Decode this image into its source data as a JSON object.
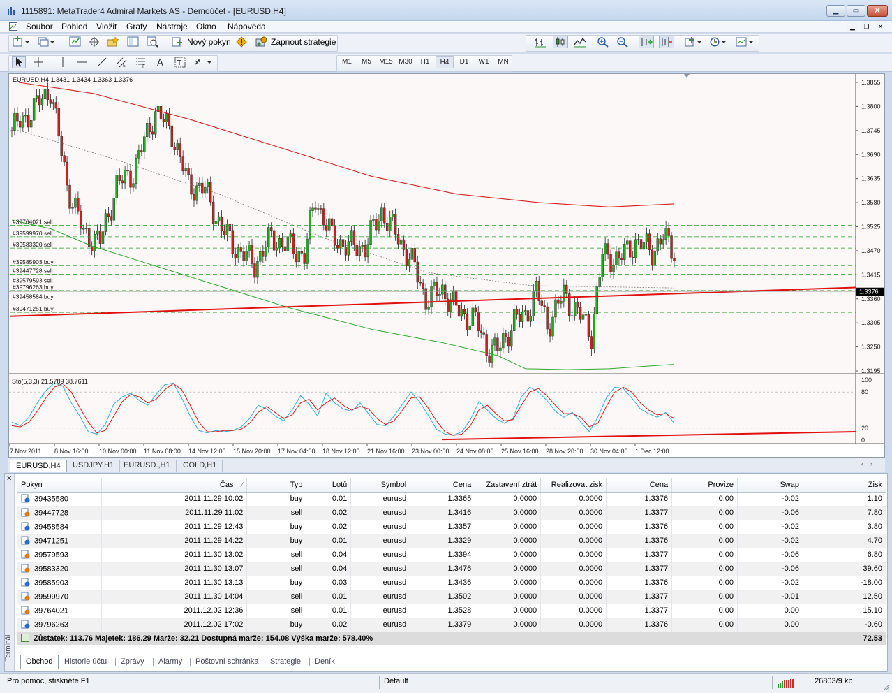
{
  "window": {
    "title": "1115891: MetaTrader4 Admiral Markets AS - Demoúčet - [EURUSD,H4]"
  },
  "menu": {
    "items": [
      "Soubor",
      "Pohled",
      "Vložit",
      "Grafy",
      "Nástroje",
      "Okno",
      "Nápověda"
    ]
  },
  "toolbar": {
    "new_order_label": "Nový pokyn",
    "autotrade_label": "Zapnout strategie"
  },
  "timeframes": [
    "M1",
    "M5",
    "M15",
    "M30",
    "H1",
    "H4",
    "D1",
    "W1",
    "MN"
  ],
  "active_timeframe": "H4",
  "chart_data": [
    {
      "type": "candlestick",
      "title": "EURUSD,H4 1.3431 1.3434 1.3363 1.3376",
      "ylim": [
        1.3195,
        1.3855
      ],
      "y_ticks": [
        "1.3855",
        "1.3800",
        "1.3745",
        "1.3690",
        "1.3635",
        "1.3580",
        "1.3525",
        "1.3470",
        "1.3415",
        "1.3360",
        "1.3305",
        "1.3250",
        "1.3195"
      ],
      "current_price": "1.3376",
      "x_ticks": [
        "7 Nov 2011",
        "8 Nov 16:00",
        "10 Nov 00:00",
        "11 Nov 08:00",
        "14 Nov 12:00",
        "15 Nov 20:00",
        "17 Nov 04:00",
        "18 Nov 12:00",
        "21 Nov 16:00",
        "23 Nov 00:00",
        "24 Nov 08:00",
        "25 Nov 16:00",
        "28 Nov 20:00",
        "30 Nov 04:00",
        "1 Dec 12:00"
      ],
      "trade_levels": [
        {
          "label": "#39764021 sell",
          "price": 1.3528
        },
        {
          "label": "#39599970 sell",
          "price": 1.3502
        },
        {
          "label": "#39583320 sell",
          "price": 1.3476
        },
        {
          "label": "#39585903 buy",
          "price": 1.3436
        },
        {
          "label": "#39447728 sell",
          "price": 1.3416
        },
        {
          "label": "#39579593 sell",
          "price": 1.3394
        },
        {
          "label": "#39796263 buy",
          "price": 1.3379
        },
        {
          "label": "#39458584 buy",
          "price": 1.3357
        },
        {
          "label": "#39471251 buy",
          "price": 1.3329
        }
      ],
      "colors": {
        "bull": "#22aa22",
        "bear": "#cc1f1f",
        "ma_slow": "#d42020",
        "ma_fast": "#2ea82e",
        "trend": "#e01010",
        "levels": "#1fa01f"
      }
    },
    {
      "type": "line",
      "title": "Sto(5,3,3) 21.5789 38.7611",
      "ylim": [
        0,
        100
      ],
      "y_ticks": [
        "100",
        "80",
        "20",
        "0"
      ],
      "series": [
        {
          "values": [
            30,
            24,
            38,
            62,
            82,
            95,
            90,
            62,
            40,
            14,
            10,
            26,
            60,
            72,
            78,
            66,
            58,
            76,
            92,
            95,
            70,
            40,
            16,
            12,
            16,
            14,
            16,
            22,
            36,
            58,
            52,
            40,
            32,
            50,
            74,
            60,
            40,
            78,
            62,
            52,
            48,
            62,
            44,
            26,
            24,
            40,
            60,
            80,
            64,
            42,
            18,
            10,
            8,
            14,
            34,
            64,
            50,
            36,
            28,
            36,
            72,
            88,
            80,
            66,
            48,
            38,
            46,
            30,
            14,
            38,
            70,
            88,
            86,
            70,
            52,
            44,
            38,
            46,
            28
          ]
        },
        {
          "values": [
            24,
            22,
            30,
            48,
            70,
            88,
            94,
            80,
            54,
            30,
            12,
            16,
            40,
            64,
            76,
            72,
            62,
            68,
            84,
            94,
            84,
            58,
            30,
            14,
            14,
            16,
            16,
            18,
            28,
            46,
            56,
            46,
            36,
            42,
            62,
            68,
            50,
            62,
            70,
            58,
            50,
            56,
            52,
            36,
            26,
            32,
            50,
            70,
            72,
            54,
            32,
            14,
            8,
            10,
            24,
            50,
            58,
            44,
            32,
            34,
            58,
            80,
            86,
            74,
            58,
            44,
            44,
            38,
            22,
            28,
            56,
            80,
            88,
            80,
            62,
            50,
            42,
            44,
            36
          ]
        }
      ],
      "colors": {
        "main": "#2bb0d8",
        "signal": "#d41c1c",
        "trend": "#e01010"
      }
    }
  ],
  "chart_tabs": [
    "EURUSD,H4",
    "USDJPY,H1",
    "EURUSD.,H1",
    "GOLD,H1"
  ],
  "orders": {
    "columns": [
      "Pokyn",
      "Čas",
      "Typ",
      "Lotů",
      "Symbol",
      "Cena",
      "Zastavení ztrát",
      "Realizovat zisk",
      "Cena",
      "Provize",
      "Swap",
      "Zisk"
    ],
    "rows": [
      [
        "39435580",
        "2011.11.29 10:02",
        "buy",
        "0.01",
        "eurusd",
        "1.3365",
        "0.0000",
        "0.0000",
        "1.3376",
        "0.00",
        "-0.02",
        "1.10"
      ],
      [
        "39447728",
        "2011.11.29 11:02",
        "sell",
        "0.02",
        "eurusd",
        "1.3416",
        "0.0000",
        "0.0000",
        "1.3377",
        "0.00",
        "-0.06",
        "7.80"
      ],
      [
        "39458584",
        "2011.11.29 12:43",
        "buy",
        "0.02",
        "eurusd",
        "1.3357",
        "0.0000",
        "0.0000",
        "1.3376",
        "0.00",
        "-0.02",
        "3.80"
      ],
      [
        "39471251",
        "2011.11.29 14:22",
        "buy",
        "0.01",
        "eurusd",
        "1.3329",
        "0.0000",
        "0.0000",
        "1.3376",
        "0.00",
        "-0.02",
        "4.70"
      ],
      [
        "39579593",
        "2011.11.30 13:02",
        "sell",
        "0.04",
        "eurusd",
        "1.3394",
        "0.0000",
        "0.0000",
        "1.3377",
        "0.00",
        "-0.06",
        "6.80"
      ],
      [
        "39583320",
        "2011.11.30 13:07",
        "sell",
        "0.04",
        "eurusd",
        "1.3476",
        "0.0000",
        "0.0000",
        "1.3377",
        "0.00",
        "-0.06",
        "39.60"
      ],
      [
        "39585903",
        "2011.11.30 13:13",
        "buy",
        "0.03",
        "eurusd",
        "1.3436",
        "0.0000",
        "0.0000",
        "1.3376",
        "0.00",
        "-0.02",
        "-18.00"
      ],
      [
        "39599970",
        "2011.11.30 14:04",
        "sell",
        "0.01",
        "eurusd",
        "1.3502",
        "0.0000",
        "0.0000",
        "1.3377",
        "0.00",
        "-0.01",
        "12.50"
      ],
      [
        "39764021",
        "2011.12.02 12:36",
        "sell",
        "0.01",
        "eurusd",
        "1.3528",
        "0.0000",
        "0.0000",
        "1.3377",
        "0.00",
        "0.00",
        "15.10"
      ],
      [
        "39796263",
        "2011.12.02 17:02",
        "buy",
        "0.02",
        "eurusd",
        "1.3379",
        "0.0000",
        "0.0000",
        "1.3376",
        "0.00",
        "0.00",
        "-0.60"
      ]
    ],
    "summary": "Zůstatek: 113.76  Majetek: 186.29  Marže: 32.21  Dostupná marže: 154.08  Výška marže: 578.40%",
    "summary_total": "72.53"
  },
  "terminal": {
    "side_label": "Terminál",
    "tabs": [
      "Obchod",
      "Historie účtu",
      "Zprávy",
      "Alarmy",
      "Poštovní schránka",
      "Strategie",
      "Deník"
    ]
  },
  "status": {
    "help": "Pro pomoc, stiskněte F1",
    "profile": "Default",
    "traffic": "26803/9 kb"
  }
}
